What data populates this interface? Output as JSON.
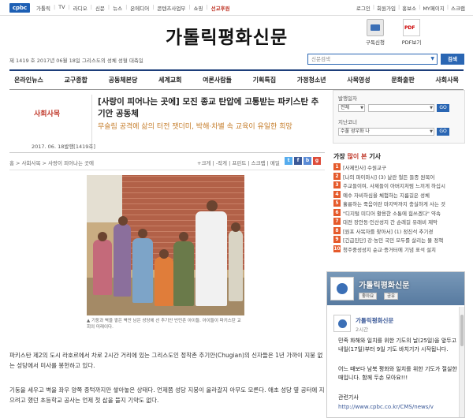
{
  "topbar": {
    "brand": "cpbc",
    "left_links": [
      "가톨릭",
      "TV",
      "라디오",
      "신문",
      "뉴스",
      "온에디어",
      "콘텐츠사업부",
      "쇼핑"
    ],
    "hot_link": "선교후원",
    "right_links": [
      "로그인",
      "회원가입",
      "홍보소",
      "MY페이지",
      "스크랩"
    ]
  },
  "masthead": {
    "title": "가톨릭평화신문",
    "subscribe_label": "구독신청",
    "pdf_label": "PDF보기"
  },
  "daterow": {
    "date_text": "제 1419 호 2017년 06월 18일 그리스도의 성체 성혈 대축일",
    "search_placeholder": "신문검색",
    "search_button": "검색"
  },
  "nav": [
    "온라인뉴스",
    "교구종합",
    "공동체본당",
    "세계교회",
    "여론사람들",
    "기획특집",
    "가정청소년",
    "사목영성",
    "문화출판",
    "사회사목"
  ],
  "article": {
    "section": "사회사목",
    "title": "[사랑이 피어나는 곳에] 모진 종교 탄압에 고통받는 파키스탄 추기안 공동체",
    "subtitle": "무슬림 공격에 삶의 터전 잿더미, 박해·차별 속 교육이 유일한 희망",
    "date": "2017. 06. 18발행[1419호]",
    "breadcrumb": "홈 > 사회사목 > 사랑이 피어나는 곳에",
    "tools": "+크게 | -작게 | 프린트 | 스크랩 | 메일",
    "social": [
      "t",
      "f",
      "b",
      "g"
    ],
    "caption": "▲ 기둥과 벽을 쌓은 벽만 남은 성당에 선 추기안 빈민촌 아이들. 아이들이 파키스탄 교회의 미래이다.",
    "p1": "파키스탄 제2의 도시 라호르에서 차로 2시간 거리에 있는 그리스도인 정착촌 추기안(Chugian)의 신자들은 1년 가까이 지붕 없는 성당에서 미사를 봉헌하고 있다.",
    "p2": "기둥을 세우고 벽을 좌우 양쪽 중턱까지만 쌓아놓은 상태다. 언제쯤 성당 지붕이 올라갈지 아무도 모른다. 애초 성당 옆 공터에 지으려고 했던 초등학교 공사는 언제 첫 삽을 뜰지 기약도 없다."
  },
  "sidebar": {
    "filter": {
      "issue_label": "발행일자",
      "issue_select": "전체",
      "go_label": "GO",
      "prev_label": "지난코너",
      "prev_select": "수풀 성우화 나"
    },
    "most_read_prefix": "가장",
    "most_read_accent": "많이 본",
    "most_read_suffix": "기사",
    "most_read": [
      "[사제인사] 수원교구",
      "[나의 파이마시] (3) 날란 철든 들종 원목어",
      "주교들이여, 사제들이 아버지처럼 느끼게 하십시",
      "예수 자비하심을 체험하는 지름길은 성체",
      "훌륭하는 죽음이란 마지막까지 충실하게 사는 것",
      "\"디지털 미디어 활용한 소통에 힘쓰겠다\" 약속",
      "대전 장안동·인산성지 간 순례길 유래비 제막",
      "[원포 사목자를 찾아서] (1) 정진석 추기경",
      "[긴급진단] 강·농민 국민 모두를 살리는 물 정책",
      "청주중성성지 순교·증거터에 기념 표석 설치"
    ]
  },
  "fb": {
    "page_name": "가톨릭평화신문",
    "like_label": "좋아요",
    "share_label": "공유",
    "post_name": "가톨릭평화신문",
    "post_time": "2시간",
    "text1": "민족 화해와 일치를 위한 기도의 날(25일)을 앞두고 내일(17일)부터 9일 기도 바치기가 시작됩니다.",
    "text2": "어느 때보다 남북 평화와 일치를 위한 기도가 절실한 때입니다. 함께 두손 모아요!!!",
    "text3": "관련기사",
    "text4": "http://www.cpbc.co.kr/CMS/news/v"
  }
}
